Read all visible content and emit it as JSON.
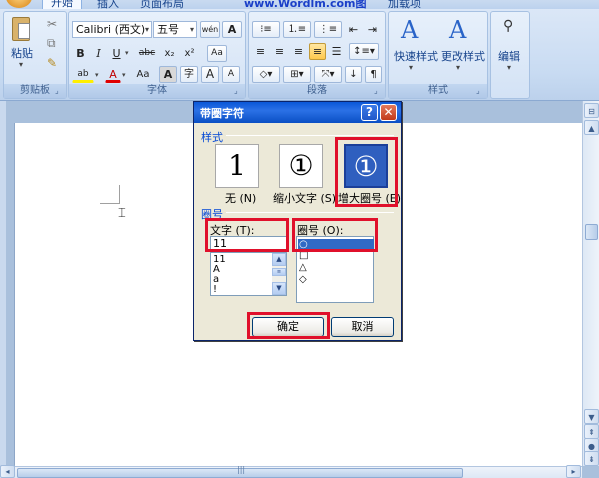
{
  "tabs": [
    "开始",
    "插入",
    "页面布局",
    "加载项"
  ],
  "watermark": "www.Wordlm.com",
  "watermark_tail": "图",
  "ribbon": {
    "clipboard": {
      "label": "剪贴板",
      "paste": "粘贴"
    },
    "font": {
      "label": "字体",
      "font_name": "Calibri (西文)",
      "font_size": "五号",
      "wen": "wén",
      "a_big": "A",
      "bold": "B",
      "italic": "I",
      "underline": "U",
      "strike": "abc",
      "sub": "x₂",
      "sup": "x²",
      "clear": "Aa",
      "highlight": "ab",
      "font_color": "A",
      "change_case": "Aa",
      "char_shade": "A",
      "enclose": "字",
      "grow": "A",
      "shrink": "A"
    },
    "paragraph": {
      "label": "段落"
    },
    "styles": {
      "label": "样式",
      "quick": "快速样式",
      "change": "更改样式"
    },
    "editing": {
      "label": "编辑"
    }
  },
  "dialog": {
    "title": "带圈字符",
    "help": "?",
    "close": "✕",
    "style_section": "样式",
    "styles": [
      {
        "glyph": "1",
        "caption": "无 (N)"
      },
      {
        "glyph": "①",
        "caption": "缩小文字 (S)"
      },
      {
        "glyph": "①",
        "caption": "增大圈号 (E)"
      }
    ],
    "circle_section": "圈号",
    "text_label": "文字 (T):",
    "text_value": "11",
    "text_list": [
      "11",
      "A",
      "a",
      "!"
    ],
    "enclosure_label": "圈号 (O):",
    "enclosures": [
      "○",
      "□",
      "△",
      "◇"
    ],
    "ok": "确定",
    "cancel": "取消"
  },
  "colors": {
    "title_bar": "#0a58d8",
    "highlight_red": "#e0102b",
    "selection": "#316ac5"
  }
}
